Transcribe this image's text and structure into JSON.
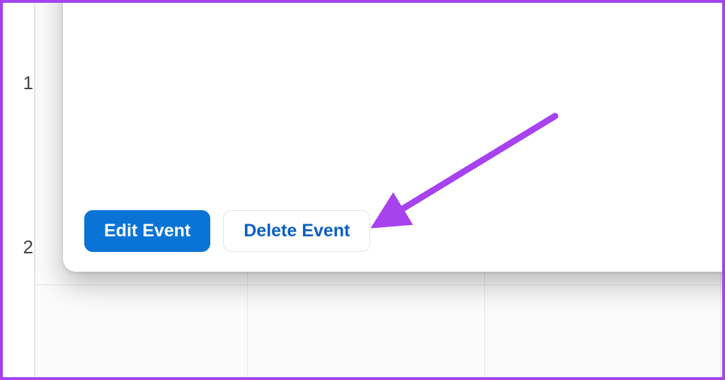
{
  "time_gutter": {
    "label_1": "1",
    "label_2": "2"
  },
  "modal": {
    "edit_label": "Edit Event",
    "delete_label": "Delete Event"
  },
  "annotation": {
    "arrow_color": "#a642ee"
  }
}
